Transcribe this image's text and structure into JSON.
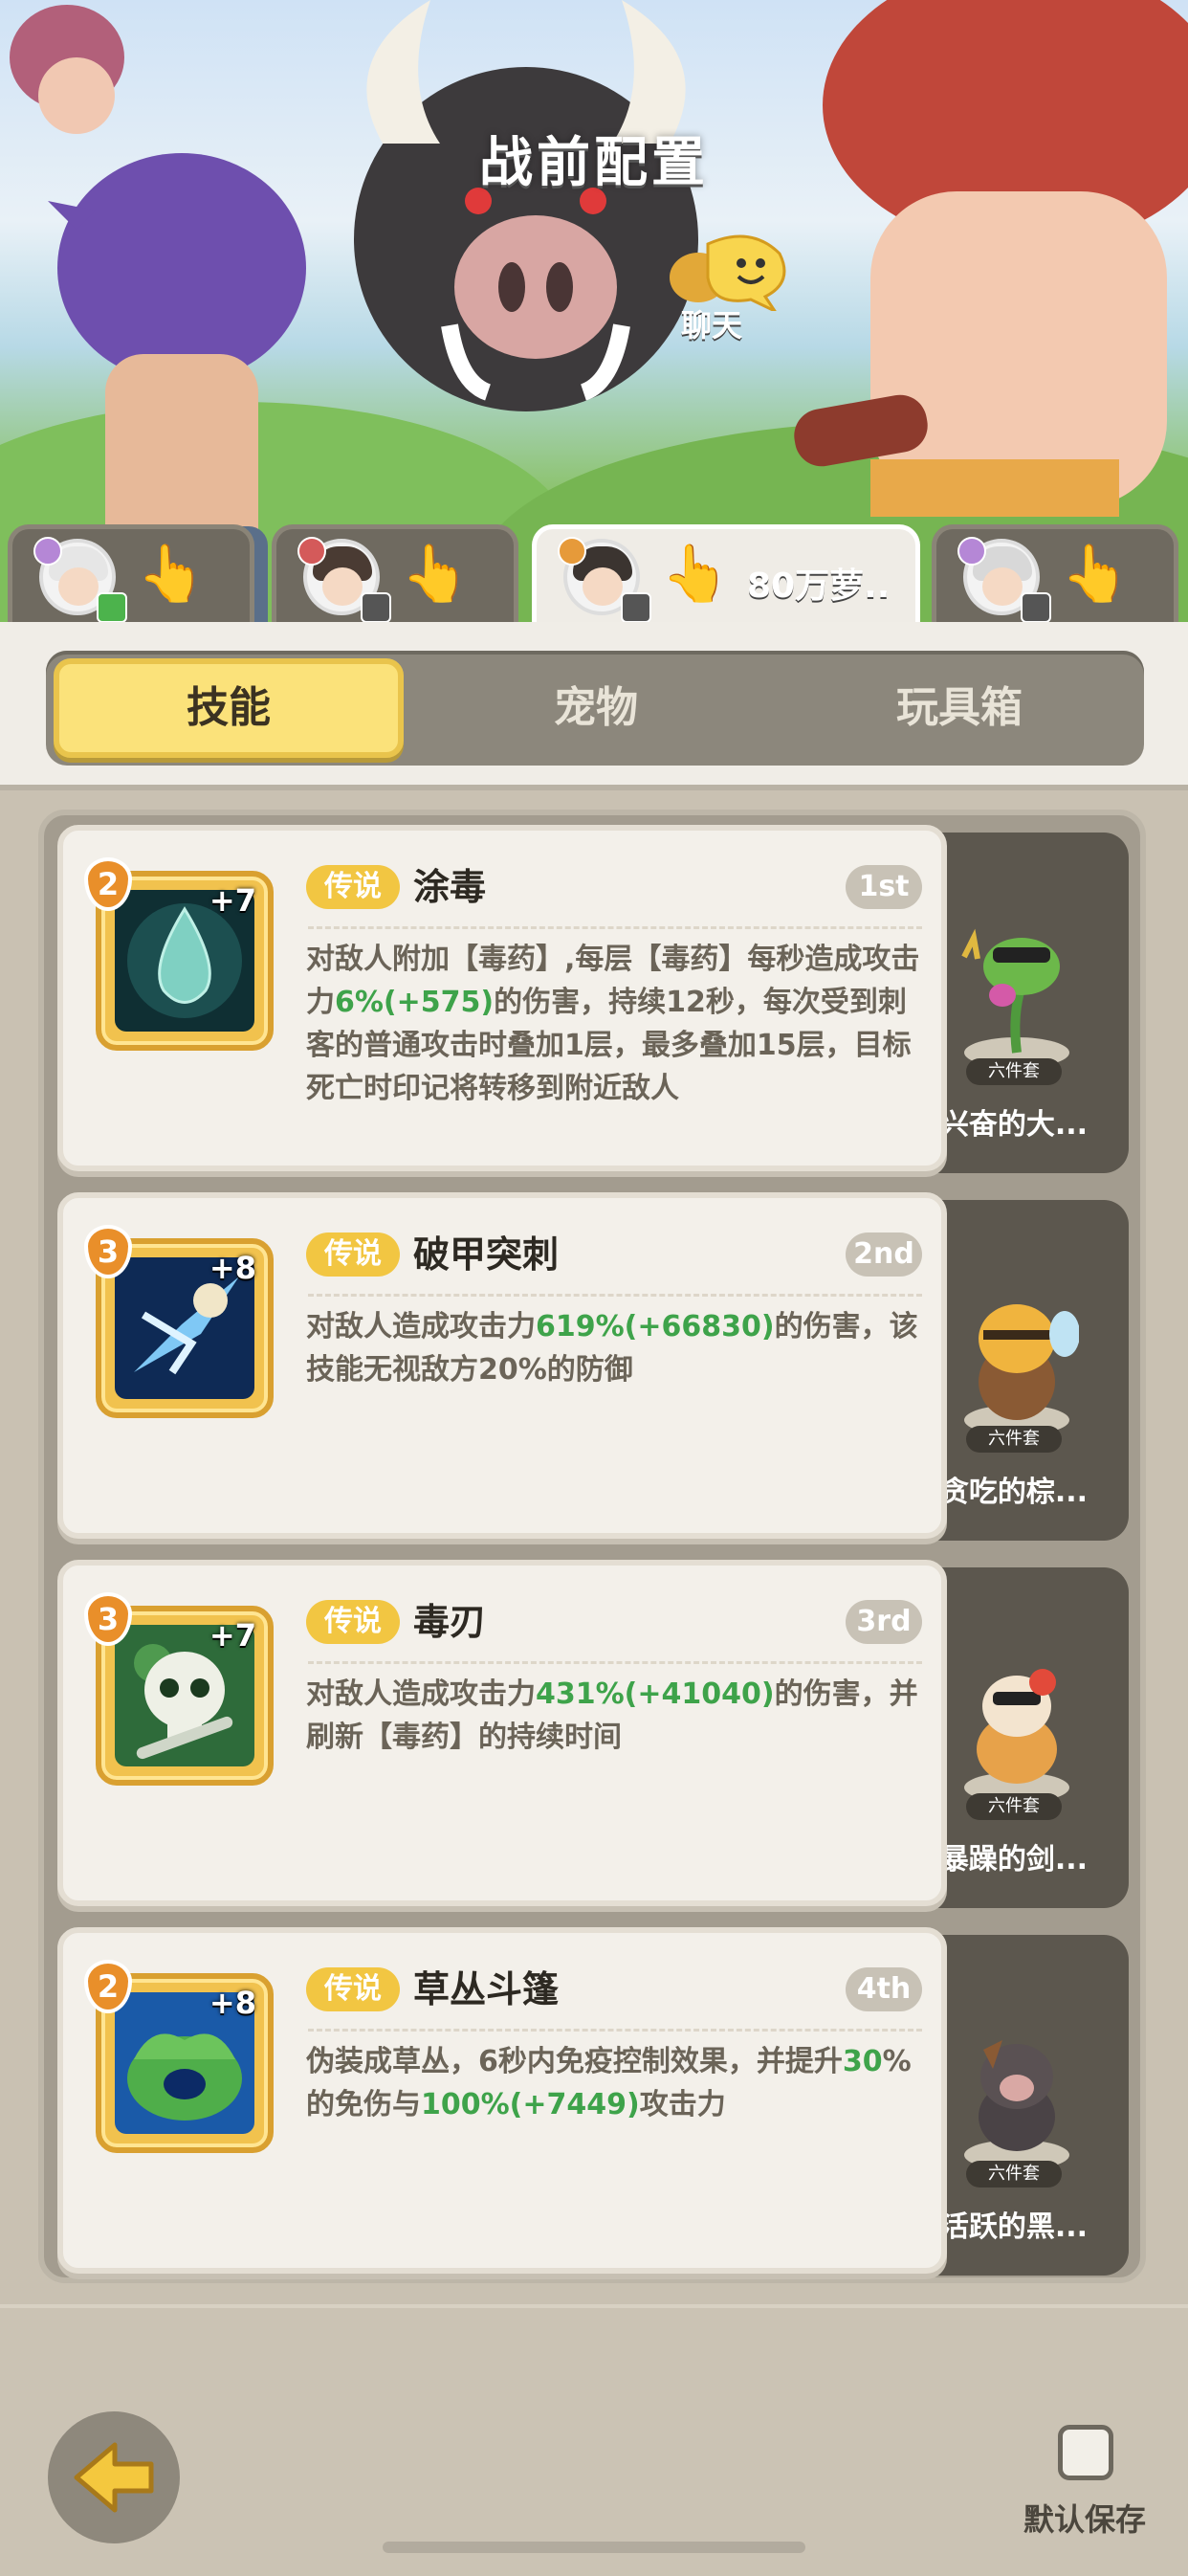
{
  "header": {
    "title": "战前配置",
    "chat_label": "聊天"
  },
  "characters": [
    {
      "power": "",
      "active": false
    },
    {
      "power": "",
      "active": false
    },
    {
      "power": "80万萝..",
      "active": true
    },
    {
      "power": "",
      "active": false
    }
  ],
  "tabs": [
    "技能",
    "宠物",
    "玩具箱"
  ],
  "active_tab": "技能",
  "skills": [
    {
      "level": "2",
      "plus": "+7",
      "rarity": "传说",
      "name": "涂毒",
      "rank": "1st",
      "desc": [
        "对敌人附加【毒药】,每层【毒药】每秒造成攻击力",
        "6%(+575)",
        "的伤害，持续12秒，每次受到刺客的普通攻击时叠加1层，最多叠加15层，目标死亡时印记将转移到附近敌人"
      ],
      "pet": {
        "set": "六件套",
        "name": "兴奋的大..."
      }
    },
    {
      "level": "3",
      "plus": "+8",
      "rarity": "传说",
      "name": "破甲突刺",
      "rank": "2nd",
      "desc": [
        "对敌人造成攻击力",
        "619%(+66830)",
        "的伤害，该技能无视敌方20%的防御"
      ],
      "pet": {
        "set": "六件套",
        "name": "贪吃的棕..."
      }
    },
    {
      "level": "3",
      "plus": "+7",
      "rarity": "传说",
      "name": "毒刃",
      "rank": "3rd",
      "desc": [
        "对敌人造成攻击力",
        "431%(+41040)",
        "的伤害，并刷新【毒药】的持续时间"
      ],
      "pet": {
        "set": "六件套",
        "name": "暴躁的剑..."
      }
    },
    {
      "level": "2",
      "plus": "+8",
      "rarity": "传说",
      "name": "草丛斗篷",
      "rank": "4th",
      "desc": [
        "伪装成草丛，6秒内免疫控制效果，并提升",
        "30",
        "%的免伤与",
        "100%(+7449)",
        "攻击力"
      ],
      "pet": {
        "set": "六件套",
        "name": "活跃的黑..."
      }
    }
  ],
  "footer": {
    "save_label": "默认保存"
  },
  "colors": {
    "accent_yellow": "#fbe27a",
    "legend_tag": "#f2c642",
    "value_green": "#3ea34a"
  }
}
